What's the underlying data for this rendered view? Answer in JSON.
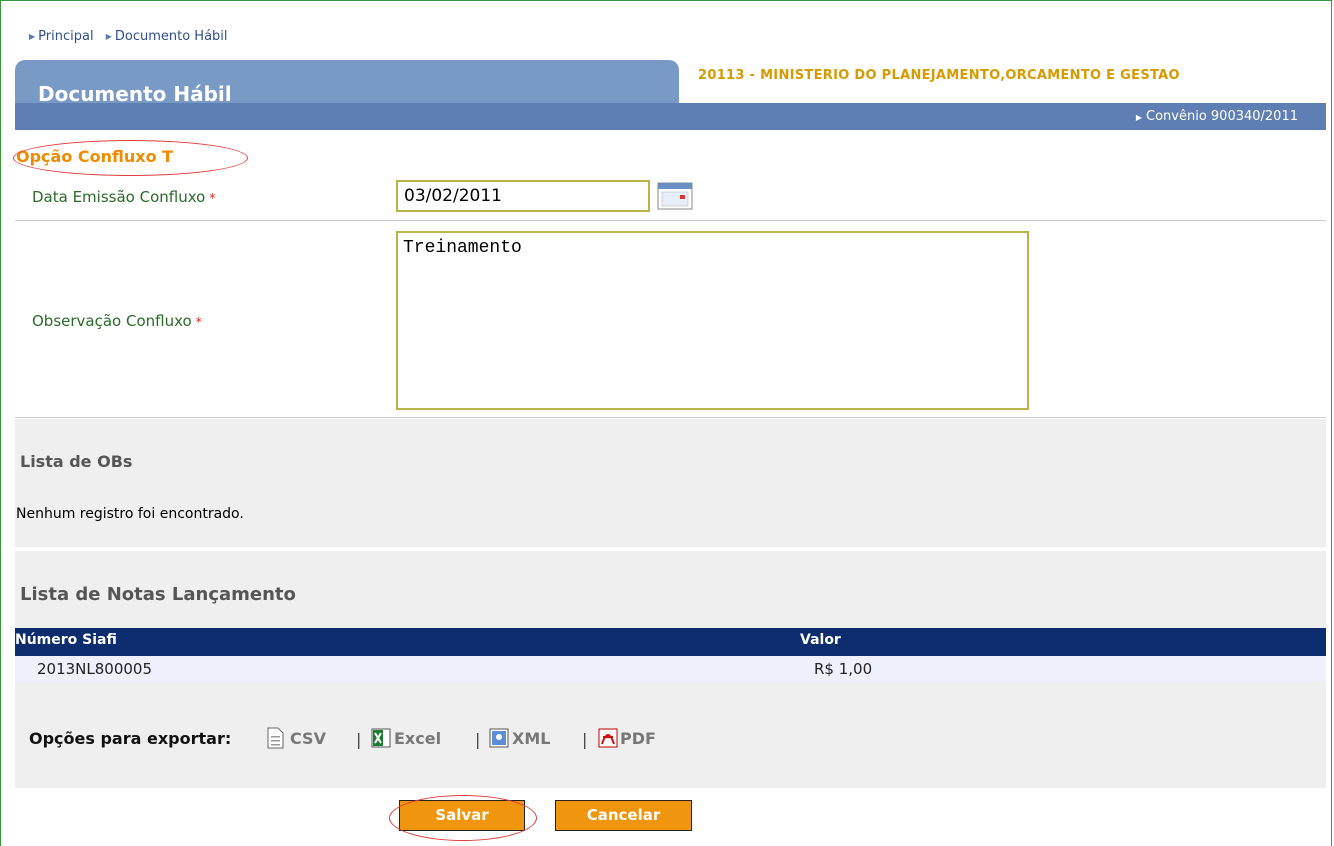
{
  "breadcrumb": {
    "items": [
      "Principal",
      "Documento Hábil"
    ]
  },
  "header": {
    "title": "Documento Hábil",
    "org": "20113 - MINISTERIO DO PLANEJAMENTO,ORCAMENTO E GESTAO",
    "convenio": "Convênio 900340/2011"
  },
  "section": {
    "title": "Opção Confluxo T"
  },
  "form": {
    "data_label": "Data Emissão Confluxo",
    "data_value": "03/02/2011",
    "obs_label": "Observação Confluxo",
    "obs_value": "Treinamento",
    "required_mark": "*"
  },
  "obs_list": {
    "title": "Lista de OBs",
    "empty": "Nenhum registro foi encontrado."
  },
  "notas": {
    "title": "Lista de Notas Lançamento",
    "columns": [
      "Número Siafi",
      "Valor"
    ],
    "rows": [
      {
        "numero": "2013NL800005",
        "valor": "R$ 1,00"
      }
    ]
  },
  "export": {
    "label": "Opções para exportar:",
    "csv": "CSV",
    "excel": "Excel",
    "xml": "XML",
    "pdf": "PDF",
    "separator": "|"
  },
  "buttons": {
    "save": "Salvar",
    "cancel": "Cancelar"
  },
  "colors": {
    "accent": "#f0960e",
    "header": "#5f7fb4",
    "table_head": "#0d2d6e"
  }
}
